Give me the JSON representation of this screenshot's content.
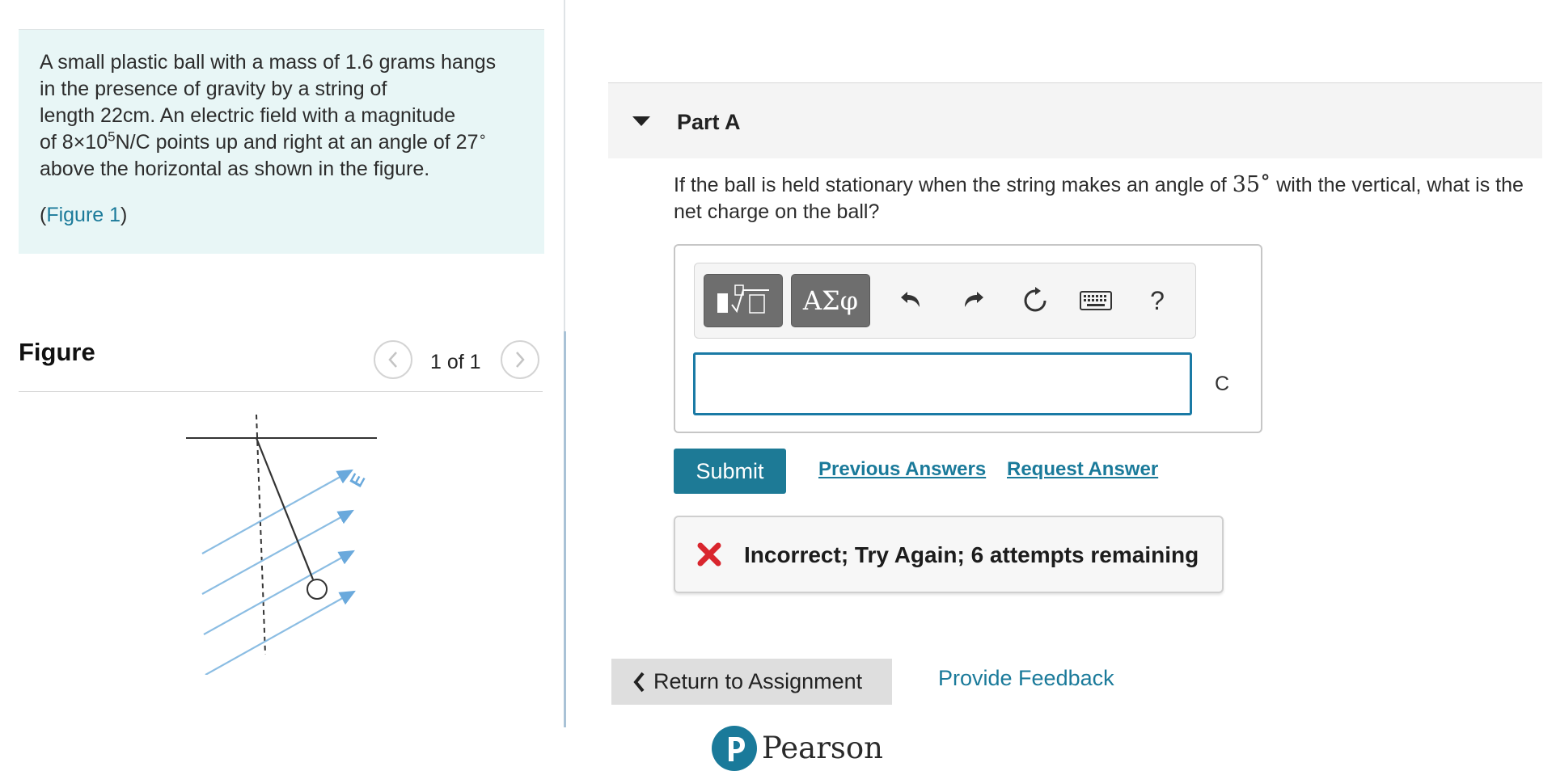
{
  "problem": {
    "line1": "A small plastic ball with a mass of 1.6 grams hangs",
    "line2": "in the presence of gravity by a string of",
    "line3": "length 22cm.  An electric field with a magnitude",
    "line4_pre": "of 8×10",
    "line4_exp": "5",
    "line4_post": "N/C points up and right at an angle of 27",
    "line4_deg": "∘",
    "line5": "above the horizontal as shown in the figure.",
    "figure_link_open": "(",
    "figure_link": "Figure 1",
    "figure_link_close": ")"
  },
  "figure": {
    "heading": "Figure",
    "pager": "1 of 1",
    "field_label": "E"
  },
  "part": {
    "title": "Part A",
    "question_pre": "If the ball is held stationary when the string makes an angle of ",
    "question_angle": "35",
    "question_deg": "∘",
    "question_post": " with the vertical, what is the net charge on the ball?"
  },
  "toolbar": {
    "symbols_label": "ΑΣφ",
    "help_label": "?"
  },
  "answer": {
    "value": "",
    "unit": "C"
  },
  "actions": {
    "submit": "Submit",
    "previous_answers": "Previous Answers",
    "request_answer": "Request Answer"
  },
  "feedback": {
    "message": "Incorrect; Try Again; 6 attempts remaining"
  },
  "footer": {
    "return": "Return to Assignment",
    "provide_feedback": "Provide Feedback",
    "brand": "Pearson"
  },
  "colors": {
    "accent": "#1d7a96",
    "error": "#d9262e",
    "problem_bg": "#e8f6f6",
    "field_arrow": "#8bbde3"
  }
}
